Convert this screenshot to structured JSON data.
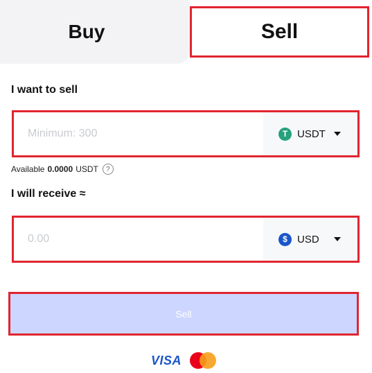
{
  "tabs": {
    "buy": "Buy",
    "sell": "Sell"
  },
  "sell_section": {
    "label": "I want to sell",
    "placeholder": "Minimum: 300",
    "currency": "USDT",
    "currency_icon": "tether-icon",
    "currency_color": "#26a17b"
  },
  "available": {
    "prefix": "Available",
    "amount": "0.0000",
    "unit": "USDT",
    "help": "?"
  },
  "receive_section": {
    "label": "I will receive ≈",
    "placeholder": "0.00",
    "currency": "USD",
    "currency_icon": "dollar-icon",
    "currency_color": "#1a56c9"
  },
  "submit": {
    "label": "Sell"
  },
  "payments": {
    "visa": "VISA"
  }
}
